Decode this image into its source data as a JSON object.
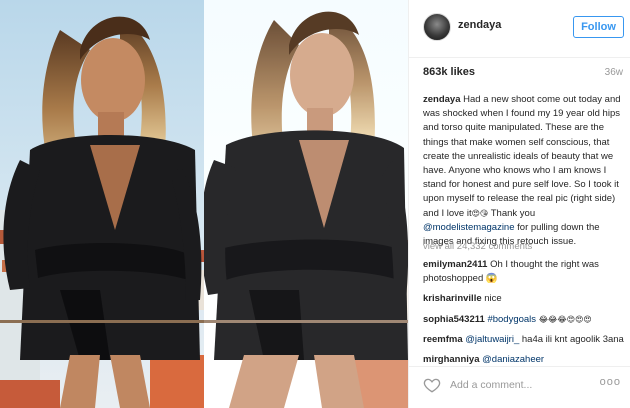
{
  "post": {
    "username": "zendaya",
    "follow_label": "Follow",
    "likes": "863k likes",
    "age": "36w",
    "caption": {
      "author": "zendaya",
      "text": "Had a new shoot come out today and was shocked when I found my 19 year old hips and torso quite manipulated. These are the things that make women self conscious, that create the unrealistic ideals of beauty that we have. Anyone who knows who I am knows I stand for honest and pure self love. So I took it upon myself to release the real pic (right side) and I love it",
      "emoji": "😍😘",
      "text2": "Thank you",
      "mention": "@modelistemagazine",
      "text3": "for pulling down the images and fixing this retouch issue."
    },
    "view_all": "view all 24,332 comments",
    "comments": [
      {
        "user": "emilyman2411",
        "text": "Oh I thought the right was photoshopped 😱"
      },
      {
        "user": "krisharinville",
        "text": "nice"
      },
      {
        "user": "sophia543211",
        "tag": "#bodygoals",
        "text": "😂😂😂😍😍😍"
      },
      {
        "user": "reemfma",
        "tag": "@jaltuwaijri_",
        "text": "ha4a ili knt agoolik 3ana"
      },
      {
        "user": "mirghanniya",
        "tag": "@daniazaheer",
        "text": ""
      }
    ],
    "add_comment_placeholder": "Add a comment...",
    "more_label": "ooo"
  },
  "icons": {
    "avatar": "avatar",
    "heart": "heart-icon",
    "more": "more-options-icon"
  },
  "colors": {
    "accent": "#3897f0",
    "muted": "#999999",
    "link": "#003569",
    "text": "#262626"
  }
}
